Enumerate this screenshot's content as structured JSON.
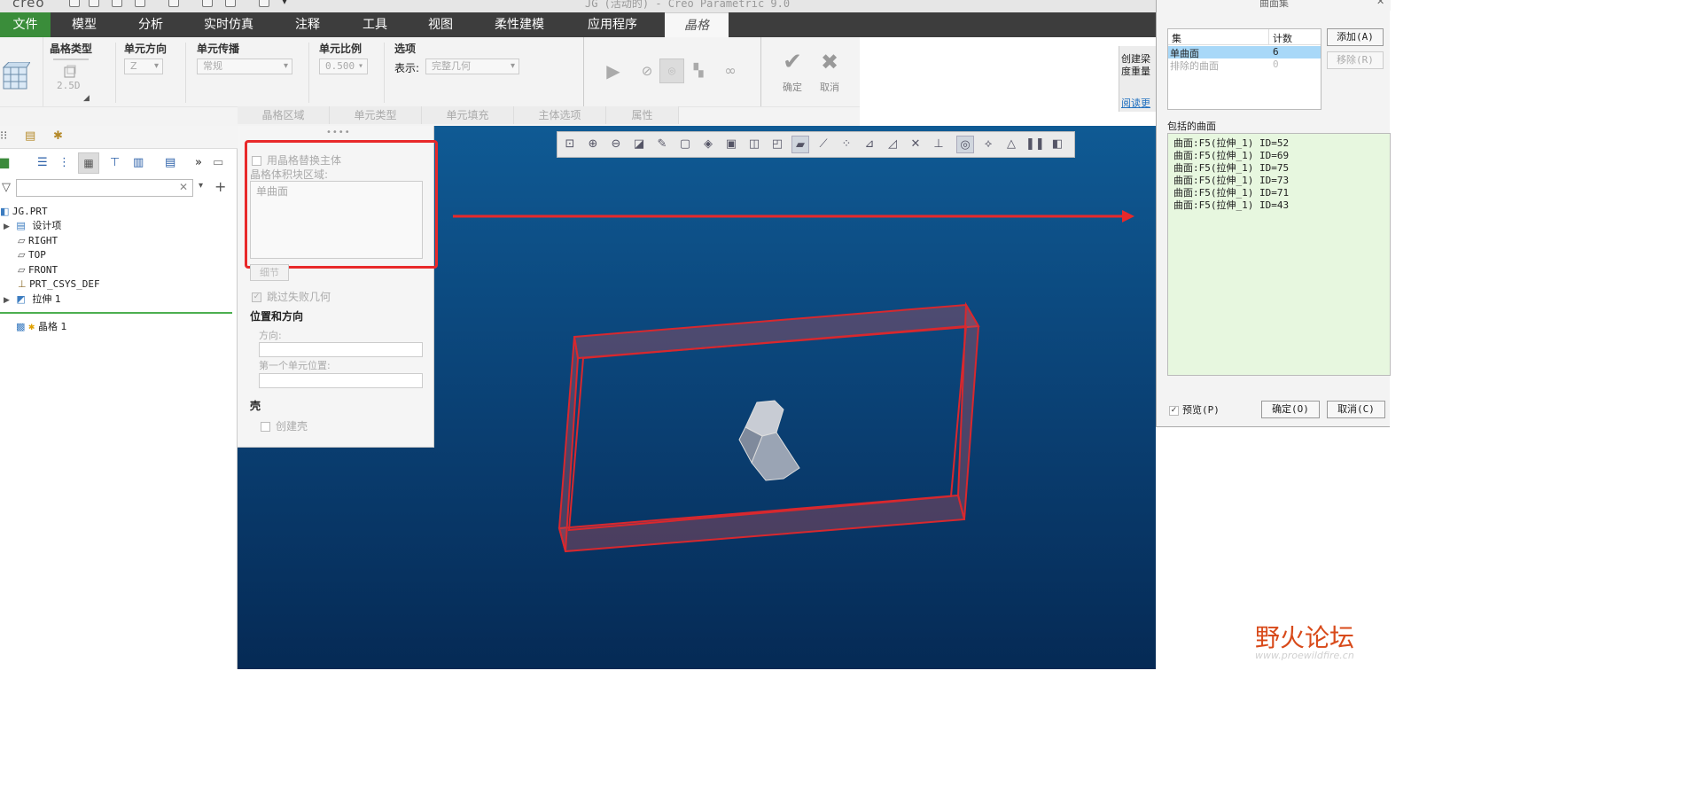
{
  "titlebar": {
    "app_logo": "creo",
    "title": "JG (活动的) - Creo Parametric 9.0"
  },
  "menu": {
    "items": [
      "文件",
      "模型",
      "分析",
      "实时仿真",
      "注释",
      "工具",
      "视图",
      "柔性建模",
      "应用程序",
      "晶格"
    ]
  },
  "ribbon": {
    "lattice_type_label": "晶格类型",
    "lattice_type_value": "2.5D",
    "cell_direction_label": "单元方向",
    "cell_direction_value": "Z",
    "cell_propagation_label": "单元传播",
    "cell_propagation_value": "常规",
    "cell_scale_label": "单元比例",
    "cell_scale_value": "0.500",
    "options_label": "选项",
    "display_label": "表示:",
    "display_value": "完整几何",
    "ok_label": "确定",
    "cancel_label": "取消",
    "subtabs": [
      "晶格区域",
      "单元类型",
      "单元填充",
      "主体选项",
      "属性"
    ],
    "side_text_1": "创建梁",
    "side_text_2": "度重量",
    "side_link": "阅读更"
  },
  "tree": {
    "items": [
      {
        "label": "JG.PRT"
      },
      {
        "label": "设计项"
      },
      {
        "label": "RIGHT"
      },
      {
        "label": "TOP"
      },
      {
        "label": "FRONT"
      },
      {
        "label": "PRT_CSYS_DEF"
      },
      {
        "label": "拉伸 1"
      },
      {
        "label": "晶格 1"
      }
    ]
  },
  "panel": {
    "replace_body_label": "用晶格替换主体",
    "volume_region_label": "晶格体积块区域:",
    "volume_region_item": "单曲面",
    "details_button": "细节",
    "skip_failed_label": "跳过失败几何",
    "position_heading": "位置和方向",
    "direction_label": "方向:",
    "first_cell_label": "第一个单元位置:",
    "shell_heading": "壳",
    "create_shell_label": "创建壳"
  },
  "dialog": {
    "title": "曲面集",
    "col_set": "集",
    "col_count": "计数",
    "rows": [
      {
        "name": "单曲面",
        "count": "6"
      },
      {
        "name": "排除的曲面",
        "count": "0"
      }
    ],
    "add_button": "添加(A)",
    "remove_button": "移除(R)",
    "included_label": "包括的曲面",
    "surfaces": [
      "曲面:F5(拉伸_1) ID=52",
      "曲面:F5(拉伸_1) ID=69",
      "曲面:F5(拉伸_1) ID=75",
      "曲面:F5(拉伸_1) ID=73",
      "曲面:F5(拉伸_1) ID=71",
      "曲面:F5(拉伸_1) ID=43"
    ],
    "preview_label": "预览(P)",
    "ok_button": "确定(O)",
    "cancel_button": "取消(C)"
  },
  "watermark": {
    "name": "野火论坛",
    "url": "www.proewildfire.cn"
  },
  "colors": {
    "accent_red": "#e8292a",
    "menu_bg": "#3d3d3d",
    "file_tab": "#3a8d3a",
    "list_bg": "#e7f7df",
    "selected_row": "#a8d8f8"
  }
}
